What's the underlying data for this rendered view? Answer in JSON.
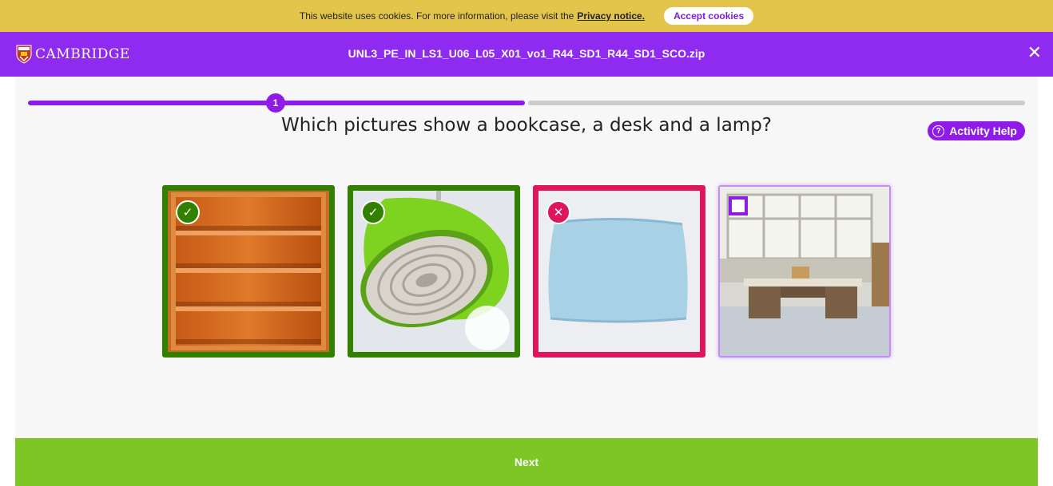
{
  "cookie_bar": {
    "text": "This website uses cookies. For more information, please visit the",
    "link": "Privacy notice.",
    "accept": "Accept cookies"
  },
  "header": {
    "logo": "CAMBRIDGE",
    "file_name": "UNL3_PE_IN_LS1_U06_L05_X01_vo1_R44_SD1_R44_SD1_SCO.zip",
    "close_icon": "close-icon"
  },
  "activity": {
    "step": "1",
    "progress": 0.5,
    "question": "Which pictures show a bookcase, a desk and a lamp?",
    "help_label": "Activity Help",
    "options": [
      {
        "item": "bookcase",
        "state": "correct",
        "badge_icon": "check-icon"
      },
      {
        "item": "lamp",
        "state": "correct",
        "badge_icon": "check-icon"
      },
      {
        "item": "pillow",
        "state": "wrong",
        "badge_icon": "cross-icon"
      },
      {
        "item": "desk",
        "state": "unselected",
        "badge_icon": "checkbox-icon"
      }
    ]
  },
  "footer": {
    "next_label": "Next"
  },
  "colors": {
    "accent": "#8f1be9",
    "header": "#8f2bf0",
    "cookie_bar": "#e4c54c",
    "correct": "#318000",
    "wrong": "#e0165c",
    "next": "#7ec625"
  }
}
